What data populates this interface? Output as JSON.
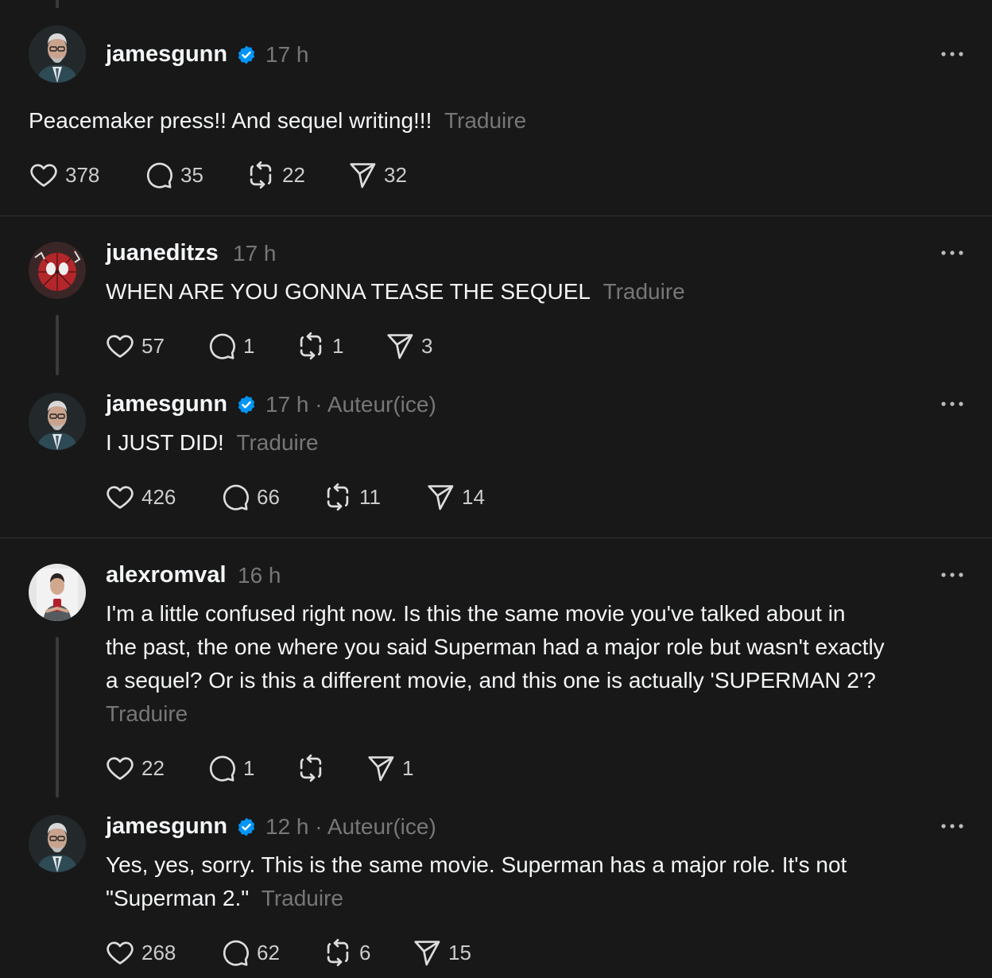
{
  "translate_label": "Traduire",
  "posts": [
    {
      "username": "jamesgunn",
      "time": "17 h",
      "text": "Peacemaker press!! And sequel writing!!!",
      "likes": "378",
      "replies": "35",
      "reposts": "22",
      "shares": "32"
    },
    {
      "username": "juaneditzs",
      "time": "17 h",
      "text": "WHEN ARE YOU GONNA TEASE THE SEQUEL",
      "likes": "57",
      "replies": "1",
      "reposts": "1",
      "shares": "3"
    },
    {
      "username": "jamesgunn",
      "time": "17 h",
      "author_tag": "Auteur(ice)",
      "text": "I JUST DID!",
      "likes": "426",
      "replies": "66",
      "reposts": "11",
      "shares": "14"
    },
    {
      "username": "alexromval",
      "time": "16 h",
      "text_lines": [
        "I'm a little confused right now. Is this the same movie you've talked about in",
        "the past, the one where you said Superman had a major role but wasn't exactly",
        "a sequel? Or is this a different movie, and this one is actually 'SUPERMAN 2'?"
      ],
      "likes": "22",
      "replies": "1",
      "reposts": "",
      "shares": "1"
    },
    {
      "username": "jamesgunn",
      "time": "12 h",
      "author_tag": "Auteur(ice)",
      "text_lines": [
        "Yes, yes, sorry. This is the same movie. Superman has a major role. It's not",
        "\"Superman 2.\""
      ],
      "likes": "268",
      "replies": "62",
      "reposts": "6",
      "shares": "15"
    }
  ],
  "icons": {
    "verified": "verified-badge-icon",
    "more": "more-options-icon",
    "like": "heart-icon",
    "reply": "comment-icon",
    "repost": "repost-icon",
    "share": "send-icon"
  },
  "colors": {
    "background": "#181818",
    "text": "#f3f5f7",
    "muted": "#777777",
    "verified": "#0095f6"
  }
}
